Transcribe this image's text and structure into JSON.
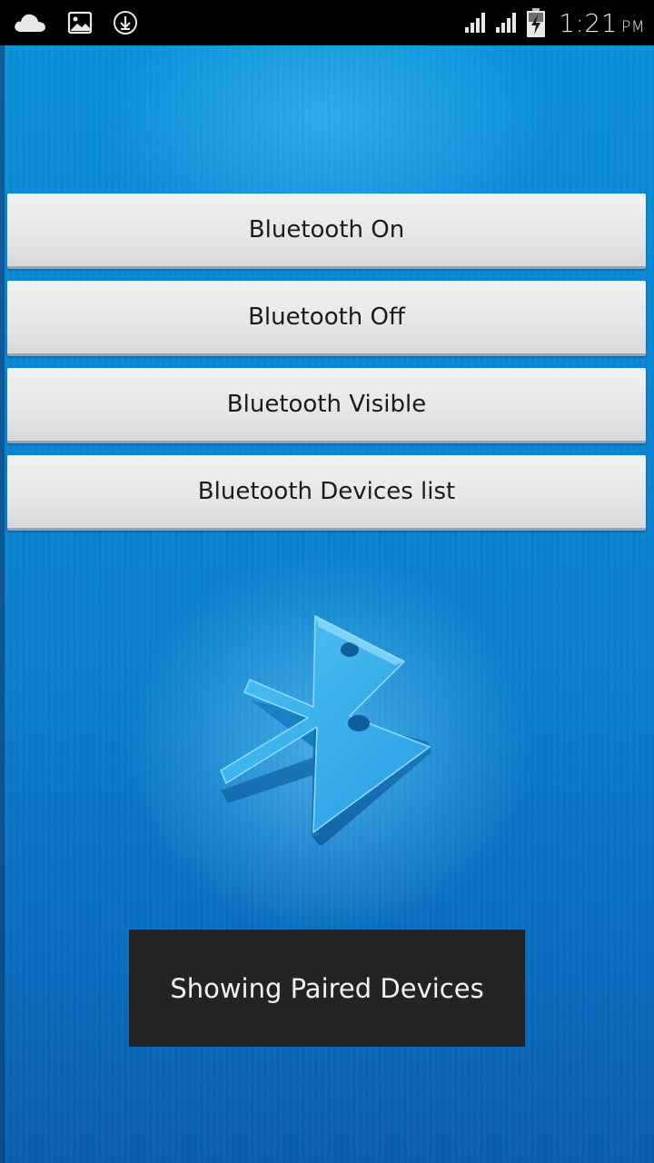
{
  "status_bar": {
    "time": "1:21",
    "ampm": "PM",
    "icons": [
      "cloud-icon",
      "image-icon",
      "download-icon",
      "signal-icon",
      "signal-icon",
      "battery-charging-icon"
    ]
  },
  "buttons": {
    "on": "Bluetooth On",
    "off": "Bluetooth Off",
    "visible": "Bluetooth Visible",
    "list": "Bluetooth Devices list"
  },
  "background_icon": "bluetooth-icon",
  "toast": {
    "message": "Showing Paired Devices"
  },
  "colors": {
    "background": "#0a86d4",
    "button": "#e6e7e8",
    "toast": "#232323"
  }
}
